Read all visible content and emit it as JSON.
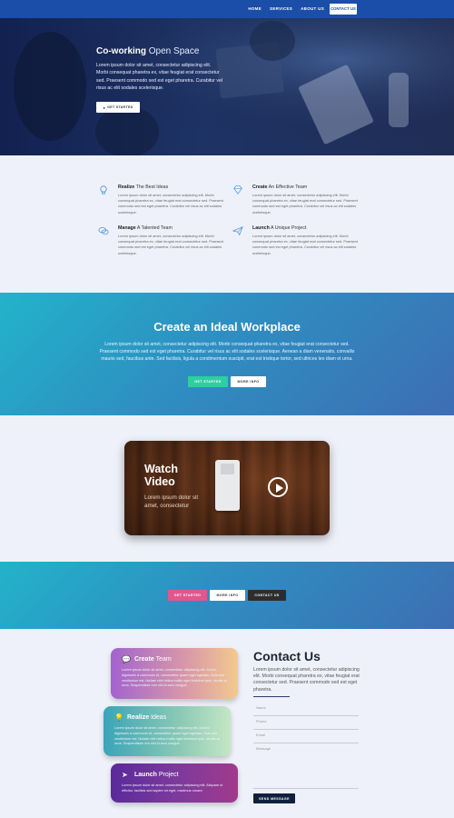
{
  "nav": {
    "links": [
      "HOME",
      "SERVICES",
      "ABOUT US"
    ],
    "contact_label": "CONTACT US",
    "bg_color": "#1a4ea8"
  },
  "hero": {
    "title_bold": "Co-working",
    "title_light": " Open Space",
    "text": "Lorem ipsum dolor sit amet, consectetur adipiscing elit. Morbi consequat pharetra ex, vitae feugiat erat consectetur sed. Praesent commodo sed est eget pharetra. Curabitur vel risus ac elit sodales scelerisque.",
    "button_label": "GET STARTED",
    "button_icon": "info-icon"
  },
  "features": [
    {
      "icon": "lightbulb-icon",
      "title_bold": "Realize",
      "title_light": " The Best Ideas",
      "text": "Lorem ipsum dolor sit amet, consectetur adipiscing elit. Morbi consequat pharetra ex, vitae feugiat erat consectetur sed. Praesent commodo sed est eget pharetra. Curabitur vel risus ac elit sodales scelerisque."
    },
    {
      "icon": "diamond-icon",
      "title_bold": "Create",
      "title_light": " An Effective Team",
      "text": "Lorem ipsum dolor sit amet, consectetur adipiscing elit. Morbi consequat pharetra ex, vitae feugiat erat consectetur sed. Praesent commodo sed est eget pharetra. Curabitur vel risus ac elit sodales scelerisque."
    },
    {
      "icon": "chat-bubbles-icon",
      "title_bold": "Manage",
      "title_light": " A Talented Team",
      "text": "Lorem ipsum dolor sit amet, consectetur adipiscing elit. Morbi consequat pharetra ex, vitae feugiat erat consectetur sed. Praesent commodo sed est eget pharetra. Curabitur vel risus ac elit sodales scelerisque."
    },
    {
      "icon": "paper-plane-icon",
      "title_bold": "Launch",
      "title_light": " A Unique Project",
      "text": "Lorem ipsum dolor sit amet, consectetur adipiscing elit. Morbi consequat pharetra ex, vitae feugiat erat consectetur sed. Praesent commodo sed est eget pharetra. Curabitur vel risus ac elit sodales scelerisque."
    }
  ],
  "cta": {
    "title": "Create an Ideal Workplace",
    "text": "Lorem ipsum dolor sit amet, consectetur adipiscing elit. Morbi consequat pharetra ex, vitae feugiat erat consectetur sed. Praesent commodo sed est eget pharetra. Curabitur vel risus ac elit sodales scelerisque. Aenean a diam venenatis, convallis mauris sed, faucibus ante. Sed facilisis, ligula a condimentum suscipit, erat est tristique tortor, sed ultrices leo diam et urna.",
    "primary_label": "GET STARTED",
    "secondary_label": "MORE INFO"
  },
  "video": {
    "title_line1": "Watch",
    "title_line2": "Video",
    "subtitle": "Lorem ipsum dolor sit amet, consectetur"
  },
  "cta2": {
    "pink_label": "GET STARTED",
    "white_label": "MORE INFO",
    "dark_label": "CONTACT US"
  },
  "cards": [
    {
      "icon": "chat-bubbles-icon",
      "title_bold": "Create",
      "title_light": " Team",
      "text": "Lorem ipsum dolor sit amet, consectetur adipiscing elit. Donec dignissim a commodo et, consectetur quam eget egestas. Duis sed vestibulum est. Nullam nibh tellus mollis eget tincidunt quis, iaculis at urna. Suspendisse non nisl id arcu congue."
    },
    {
      "icon": "lightbulb-icon",
      "title_bold": "Realize",
      "title_light": " Ideas",
      "text": "Lorem ipsum dolor sit amet, consectetur adipiscing elit. Donec dignissim a commodo et, consectetur quam eget egestas. Duis sed vestibulum est. Nullam nibh tellus mollis eget tincidunt quis, iaculis at urna. Suspendisse non nisl id arcu congue."
    },
    {
      "icon": "paper-plane-icon",
      "title_bold": "Launch",
      "title_light": " Project",
      "text": "Lorem ipsum dolor sit amet, consectetur adipiscing elit. Aliquam ut efficitur, facilisis sed sapien mi eget, maximus ornare."
    }
  ],
  "contact": {
    "title": "Contact Us",
    "text": "Lorem ipsum dolor sit amet, consectetur adipiscing elit. Morbi consequat pharetra ex, vitae feugiat erat consectetur sed. Praesent commodo sed est eget pharetra.",
    "placeholders": {
      "name": "Name",
      "phone": "Phone",
      "email": "Email",
      "message": "Message"
    },
    "send_label": "SEND MESSAGE"
  }
}
